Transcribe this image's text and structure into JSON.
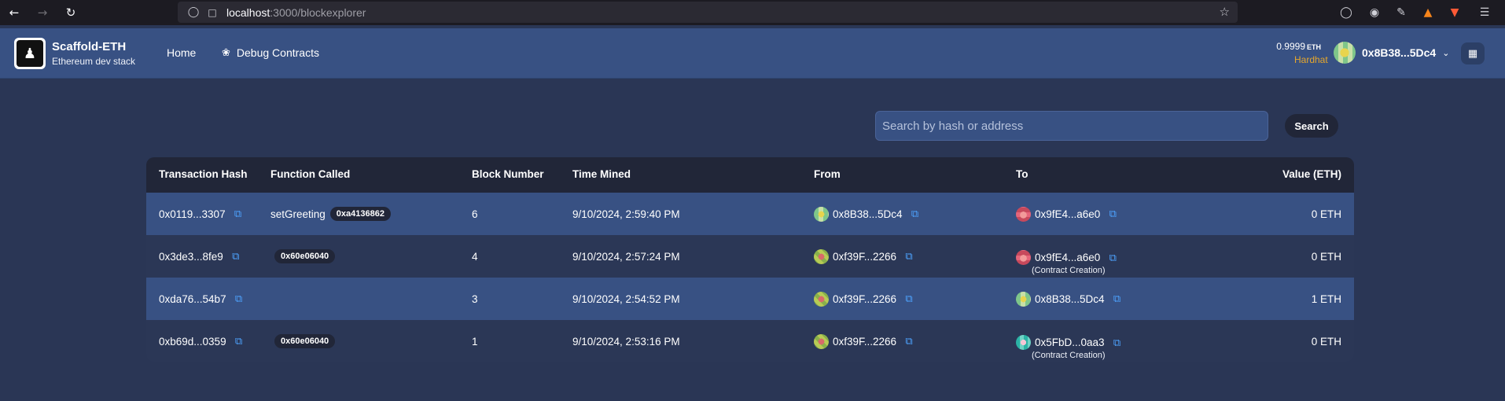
{
  "browser": {
    "url_host": "localhost",
    "url_rest": ":3000/blockexplorer"
  },
  "header": {
    "brand_title": "Scaffold-ETH",
    "brand_subtitle": "Ethereum dev stack",
    "nav": [
      {
        "label": "Home"
      },
      {
        "label": "Debug Contracts"
      }
    ],
    "balance_value": "0.9999",
    "balance_unit": "ETH",
    "network": "Hardhat",
    "account": "0x8B38...5Dc4"
  },
  "search": {
    "placeholder": "Search by hash or address",
    "button_label": "Search"
  },
  "table": {
    "columns": [
      "Transaction Hash",
      "Function Called",
      "Block Number",
      "Time Mined",
      "From",
      "To",
      "Value (ETH)"
    ],
    "rows": [
      {
        "hash": "0x0119...3307",
        "function_name": "setGreeting",
        "selector": "0xa4136862",
        "block": "6",
        "time": "9/10/2024, 2:59:40 PM",
        "from": "0x8B38...5Dc4",
        "from_avatar": "green",
        "to": "0x9fE4...a6e0",
        "to_avatar": "red",
        "to_note": "",
        "value": "0 ETH"
      },
      {
        "hash": "0x3de3...8fe9",
        "function_name": "",
        "selector": "0x60e06040",
        "block": "4",
        "time": "9/10/2024, 2:57:24 PM",
        "from": "0xf39F...2266",
        "from_avatar": "olive",
        "to": "0x9fE4...a6e0",
        "to_avatar": "red",
        "to_note": "(Contract Creation)",
        "value": "0 ETH"
      },
      {
        "hash": "0xda76...54b7",
        "function_name": "",
        "selector": "",
        "block": "3",
        "time": "9/10/2024, 2:54:52 PM",
        "from": "0xf39F...2266",
        "from_avatar": "olive",
        "to": "0x8B38...5Dc4",
        "to_avatar": "green",
        "to_note": "",
        "value": "1 ETH"
      },
      {
        "hash": "0xb69d...0359",
        "function_name": "",
        "selector": "0x60e06040",
        "block": "1",
        "time": "9/10/2024, 2:53:16 PM",
        "from": "0xf39F...2266",
        "from_avatar": "olive",
        "to": "0x5FbD...0aa3",
        "to_avatar": "teal",
        "to_note": "(Contract Creation)",
        "value": "0 ETH"
      }
    ]
  },
  "colors": {
    "page_bg": "#2a3655",
    "header_bg": "#385183",
    "table_head_bg": "#212638",
    "row_highlight": "#385183",
    "row_alt": "#2b3756",
    "copy_icon": "#4da3ff",
    "network_color": "#e6a72c"
  }
}
